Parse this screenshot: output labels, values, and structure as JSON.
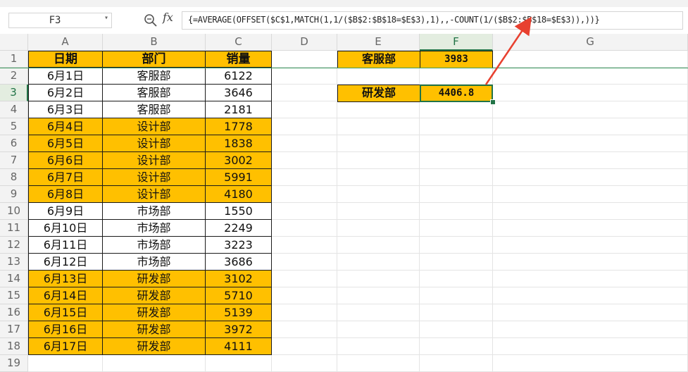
{
  "name_box": {
    "value": "F3"
  },
  "formula_bar": {
    "fx_label": "fx",
    "formula": "{=AVERAGE(OFFSET($C$1,MATCH(1,1/($B$2:$B$18=$E$3),1),,-COUNT(1/($B$2:$B$18=$E$3)),))}"
  },
  "columns": [
    "A",
    "B",
    "C",
    "D",
    "E",
    "F",
    "G"
  ],
  "active_column": "F",
  "row_numbers": [
    "1",
    "2",
    "3",
    "4",
    "5",
    "6",
    "7",
    "8",
    "9",
    "10",
    "11",
    "12",
    "13",
    "14",
    "15",
    "16",
    "17",
    "18",
    "19"
  ],
  "active_row": "3",
  "table": {
    "headers": [
      "日期",
      "部门",
      "销量"
    ],
    "rows": [
      {
        "date": "6月1日",
        "dept": "客服部",
        "sales": "6122",
        "highlight": false
      },
      {
        "date": "6月2日",
        "dept": "客服部",
        "sales": "3646",
        "highlight": false
      },
      {
        "date": "6月3日",
        "dept": "客服部",
        "sales": "2181",
        "highlight": false
      },
      {
        "date": "6月4日",
        "dept": "设计部",
        "sales": "1778",
        "highlight": true
      },
      {
        "date": "6月5日",
        "dept": "设计部",
        "sales": "1838",
        "highlight": true
      },
      {
        "date": "6月6日",
        "dept": "设计部",
        "sales": "3002",
        "highlight": true
      },
      {
        "date": "6月7日",
        "dept": "设计部",
        "sales": "5991",
        "highlight": true
      },
      {
        "date": "6月8日",
        "dept": "设计部",
        "sales": "4180",
        "highlight": true
      },
      {
        "date": "6月9日",
        "dept": "市场部",
        "sales": "1550",
        "highlight": false
      },
      {
        "date": "6月10日",
        "dept": "市场部",
        "sales": "2249",
        "highlight": false
      },
      {
        "date": "6月11日",
        "dept": "市场部",
        "sales": "3223",
        "highlight": false
      },
      {
        "date": "6月12日",
        "dept": "市场部",
        "sales": "3686",
        "highlight": false
      },
      {
        "date": "6月13日",
        "dept": "研发部",
        "sales": "3102",
        "highlight": true
      },
      {
        "date": "6月14日",
        "dept": "研发部",
        "sales": "5710",
        "highlight": true
      },
      {
        "date": "6月15日",
        "dept": "研发部",
        "sales": "5139",
        "highlight": true
      },
      {
        "date": "6月16日",
        "dept": "研发部",
        "sales": "3972",
        "highlight": true
      },
      {
        "date": "6月17日",
        "dept": "研发部",
        "sales": "4111",
        "highlight": true
      }
    ]
  },
  "summary": [
    {
      "label": "客服部",
      "value": "3983"
    },
    {
      "label": "研发部",
      "value": "4406.8"
    }
  ],
  "colors": {
    "highlight": "#ffc000",
    "selection": "#217346",
    "arrow": "#e8402f"
  }
}
